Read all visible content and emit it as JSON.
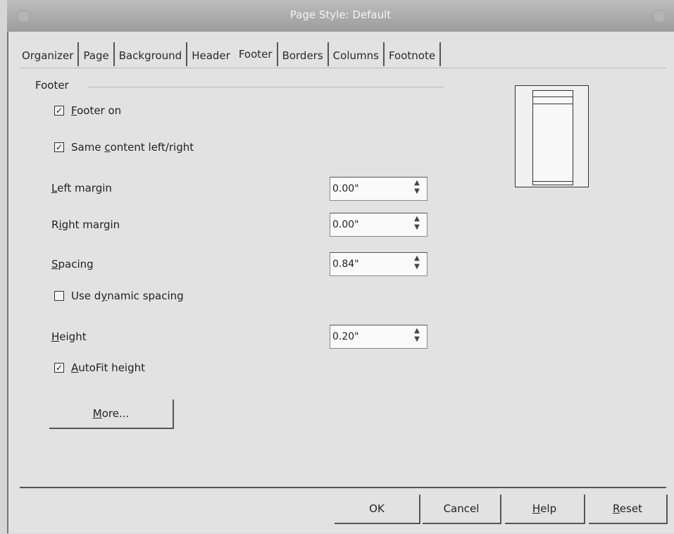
{
  "window": {
    "title": "Page Style: Default"
  },
  "tabs": [
    {
      "label": "Organizer"
    },
    {
      "label": "Page"
    },
    {
      "label": "Background"
    },
    {
      "label": "Header"
    },
    {
      "label": "Footer",
      "active": true
    },
    {
      "label": "Borders"
    },
    {
      "label": "Columns"
    },
    {
      "label": "Footnote"
    }
  ],
  "footer_section": {
    "legend": "Footer",
    "footer_on": {
      "label": "Footer on",
      "accel": "F",
      "checked": true
    },
    "same_content": {
      "label_pre": "Same ",
      "accel": "c",
      "label_post": "ontent left/right",
      "checked": true
    },
    "left_margin": {
      "label_accel": "L",
      "label_rest": "eft margin",
      "value": "0.00\""
    },
    "right_margin": {
      "label_pre": "R",
      "label_accel": "i",
      "label_rest": "ght margin",
      "value": "0.00\""
    },
    "spacing": {
      "label_accel": "S",
      "label_rest": "pacing",
      "value": "0.84\""
    },
    "dynamic_spacing": {
      "label_pre": "Use d",
      "accel": "y",
      "label_post": "namic spacing",
      "checked": false
    },
    "height": {
      "label_accel": "H",
      "label_rest": "eight",
      "value": "0.20\""
    },
    "autofit": {
      "accel": "A",
      "label_post": "utoFit height",
      "checked": true
    },
    "more_button": {
      "accel": "M",
      "label_rest": "ore..."
    }
  },
  "buttons": {
    "ok": "OK",
    "cancel": "Cancel",
    "help_accel": "H",
    "help_rest": "elp",
    "reset_accel": "R",
    "reset_rest": "eset"
  }
}
